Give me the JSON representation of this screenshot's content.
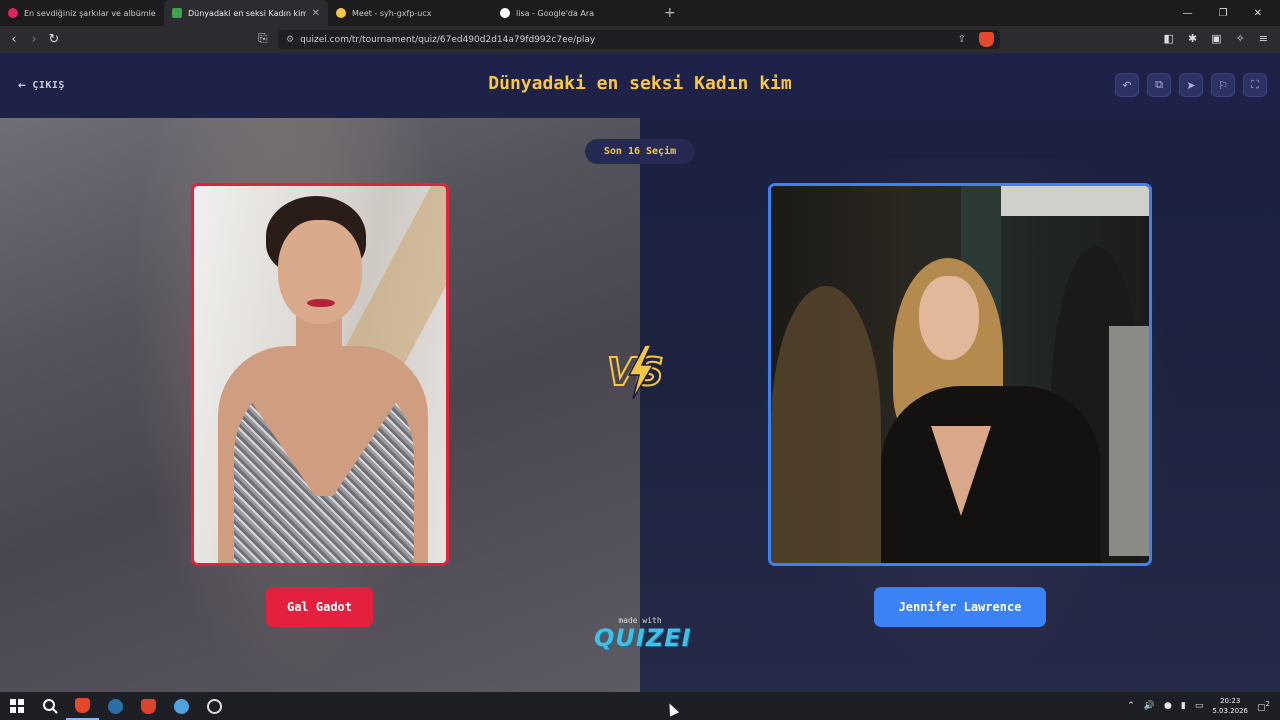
{
  "browser": {
    "tabs": [
      {
        "title": "En sevdiğiniz şarkılar ve albümleri di",
        "favicon_color": "#e0245e"
      },
      {
        "title": "Dünyadaki en seksi Kadın kim - Qu",
        "favicon_color": "#3fa34d"
      },
      {
        "title": "Meet - syh-gxfp-ucx",
        "favicon_color": "#f6c744"
      },
      {
        "title": "lisa - Google'da Ara",
        "favicon_color": "#ffffff"
      }
    ],
    "new_tab": "+",
    "url": "quizei.com/tr/tournament/quiz/67ed490d2d14a79fd992c7ee/play"
  },
  "header": {
    "exit_label": "ÇIKIŞ",
    "title": "Dünyadaki en seksi Kadın kim"
  },
  "round_badge": "Son 16 Seçim",
  "contestants": {
    "left": {
      "name": "Gal Gadot",
      "color": "#e3213f"
    },
    "right": {
      "name": "Jennifer Lawrence",
      "color": "#3b82f6"
    }
  },
  "vs_label": "VS",
  "footer": {
    "made_with": "made with",
    "brand": "QUIZEI"
  },
  "taskbar": {
    "time": "20:23",
    "date": "5.03.2026",
    "notification_count": "2"
  },
  "colors": {
    "accent_yellow": "#f6c744",
    "header_bg": "#1e2148"
  }
}
